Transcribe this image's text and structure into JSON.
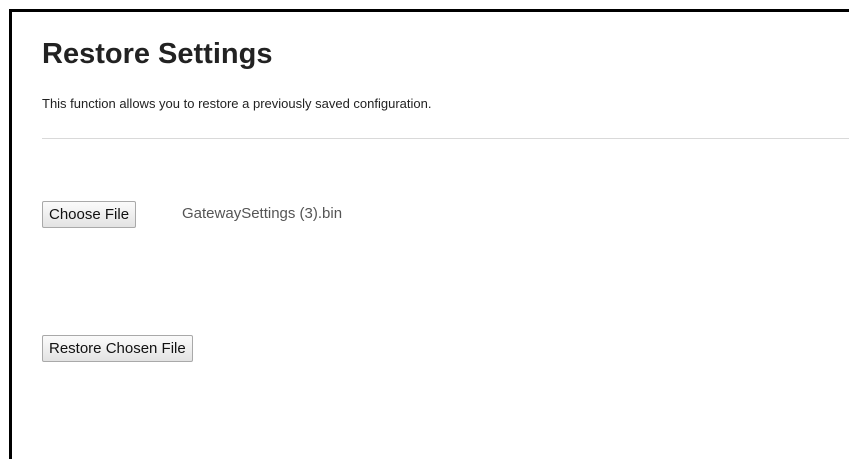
{
  "page": {
    "title": "Restore Settings",
    "description": "This function allows you to restore a previously saved configuration."
  },
  "file_input": {
    "button_label": "Choose File",
    "selected_file": "GatewaySettings (3).bin"
  },
  "actions": {
    "restore_label": "Restore Chosen File"
  }
}
